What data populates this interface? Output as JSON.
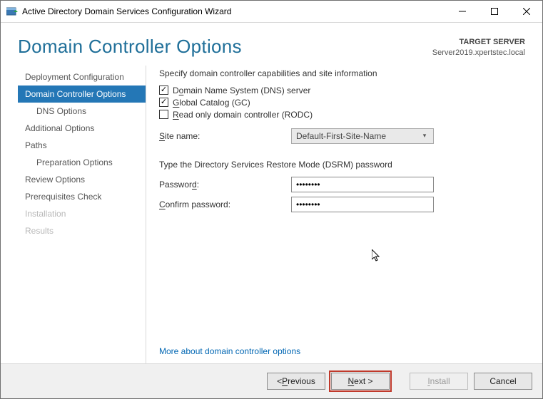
{
  "window": {
    "title": "Active Directory Domain Services Configuration Wizard"
  },
  "header": {
    "title": "Domain Controller Options",
    "target_label": "TARGET SERVER",
    "target_value": "Server2019.xpertstec.local"
  },
  "nav": [
    {
      "label": "Deployment Configuration",
      "sub": false,
      "active": false,
      "dim": false
    },
    {
      "label": "Domain Controller Options",
      "sub": false,
      "active": true,
      "dim": false
    },
    {
      "label": "DNS Options",
      "sub": true,
      "active": false,
      "dim": false
    },
    {
      "label": "Additional Options",
      "sub": false,
      "active": false,
      "dim": false
    },
    {
      "label": "Paths",
      "sub": false,
      "active": false,
      "dim": false
    },
    {
      "label": "Preparation Options",
      "sub": true,
      "active": false,
      "dim": false
    },
    {
      "label": "Review Options",
      "sub": false,
      "active": false,
      "dim": false
    },
    {
      "label": "Prerequisites Check",
      "sub": false,
      "active": false,
      "dim": false
    },
    {
      "label": "Installation",
      "sub": false,
      "active": false,
      "dim": true
    },
    {
      "label": "Results",
      "sub": false,
      "active": false,
      "dim": true
    }
  ],
  "content": {
    "cap_heading": "Specify domain controller capabilities and site information",
    "checks": {
      "dns": {
        "label_pre": "D",
        "label_accel": "o",
        "label_post": "main Name System (DNS) server",
        "checked": true
      },
      "gc": {
        "label_pre": "",
        "label_accel": "G",
        "label_post": "lobal Catalog (GC)",
        "checked": true
      },
      "rodc": {
        "label_pre": "",
        "label_accel": "R",
        "label_post": "ead only domain controller (RODC)",
        "checked": false
      }
    },
    "site": {
      "label_pre": "",
      "label_accel": "S",
      "label_post": "ite name:",
      "value": "Default-First-Site-Name"
    },
    "dsrm_heading": "Type the Directory Services Restore Mode (DSRM) password",
    "pwd": {
      "label_pre": "Passwor",
      "label_accel": "d",
      "label_post": ":",
      "value": "••••••••"
    },
    "cpwd": {
      "label_pre": "",
      "label_accel": "C",
      "label_post": "onfirm password:",
      "value": "••••••••"
    },
    "more_link": "More about domain controller options"
  },
  "footer": {
    "prev_pre": "< ",
    "prev_accel": "P",
    "prev_post": "revious",
    "next_pre": "",
    "next_accel": "N",
    "next_post": "ext >",
    "install_pre": "",
    "install_accel": "I",
    "install_post": "nstall",
    "cancel": "Cancel"
  }
}
